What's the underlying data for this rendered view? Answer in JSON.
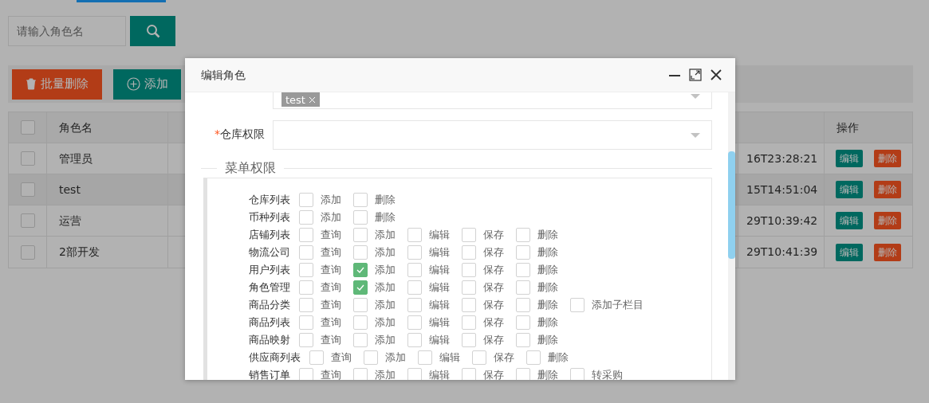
{
  "search": {
    "placeholder": "请输入角色名"
  },
  "toolbar": [
    {
      "label": "批量删除",
      "kind": "delete"
    },
    {
      "label": "添加",
      "kind": "add"
    }
  ],
  "table": {
    "all_checked": false,
    "name_header": "角色名",
    "actions_header": "操作",
    "rows": [
      {
        "name": "管理员",
        "time": "16T23:28:21",
        "checked": false,
        "hovered": false,
        "actions": [
          "编辑",
          "删除"
        ]
      },
      {
        "name": "test",
        "time": "15T14:51:04",
        "checked": false,
        "hovered": true,
        "actions": [
          "编辑",
          "删除"
        ]
      },
      {
        "name": "运营",
        "time": "29T10:39:42",
        "checked": false,
        "hovered": false,
        "actions": [
          "编辑",
          "删除"
        ]
      },
      {
        "name": "2部开发",
        "time": "29T10:41:39",
        "checked": false,
        "hovered": false,
        "actions": [
          "编辑",
          "删除"
        ]
      }
    ]
  },
  "modal": {
    "title": "编辑角色",
    "shop_select": {
      "tags": [
        "test"
      ]
    },
    "warehouse_select": {
      "label": "仓库权限",
      "required_mark": "*"
    },
    "menu_legend": "菜单权限",
    "menus": [
      {
        "label": "仓库列表",
        "perms": [
          {
            "label": "添加",
            "checked": false
          },
          {
            "label": "删除",
            "checked": false
          }
        ]
      },
      {
        "label": "币种列表",
        "perms": [
          {
            "label": "添加",
            "checked": false
          },
          {
            "label": "删除",
            "checked": false
          }
        ]
      },
      {
        "label": "店铺列表",
        "perms": [
          {
            "label": "查询",
            "checked": false
          },
          {
            "label": "添加",
            "checked": false
          },
          {
            "label": "编辑",
            "checked": false
          },
          {
            "label": "保存",
            "checked": false
          },
          {
            "label": "删除",
            "checked": false
          }
        ]
      },
      {
        "label": "物流公司",
        "perms": [
          {
            "label": "查询",
            "checked": false
          },
          {
            "label": "添加",
            "checked": false
          },
          {
            "label": "编辑",
            "checked": false
          },
          {
            "label": "保存",
            "checked": false
          },
          {
            "label": "删除",
            "checked": false
          }
        ]
      },
      {
        "label": "用户列表",
        "perms": [
          {
            "label": "查询",
            "checked": false
          },
          {
            "label": "添加",
            "checked": true
          },
          {
            "label": "编辑",
            "checked": false
          },
          {
            "label": "保存",
            "checked": false
          },
          {
            "label": "删除",
            "checked": false
          }
        ]
      },
      {
        "label": "角色管理",
        "perms": [
          {
            "label": "查询",
            "checked": false
          },
          {
            "label": "添加",
            "checked": true
          },
          {
            "label": "编辑",
            "checked": false
          },
          {
            "label": "保存",
            "checked": false
          },
          {
            "label": "删除",
            "checked": false
          }
        ]
      },
      {
        "label": "商品分类",
        "perms": [
          {
            "label": "查询",
            "checked": false
          },
          {
            "label": "添加",
            "checked": false
          },
          {
            "label": "编辑",
            "checked": false
          },
          {
            "label": "保存",
            "checked": false
          },
          {
            "label": "删除",
            "checked": false
          },
          {
            "label": "添加子栏目",
            "checked": false
          }
        ]
      },
      {
        "label": "商品列表",
        "perms": [
          {
            "label": "查询",
            "checked": false
          },
          {
            "label": "添加",
            "checked": false
          },
          {
            "label": "编辑",
            "checked": false
          },
          {
            "label": "保存",
            "checked": false
          },
          {
            "label": "删除",
            "checked": false
          }
        ]
      },
      {
        "label": "商品映射",
        "perms": [
          {
            "label": "查询",
            "checked": false
          },
          {
            "label": "添加",
            "checked": false
          },
          {
            "label": "编辑",
            "checked": false
          },
          {
            "label": "保存",
            "checked": false
          },
          {
            "label": "删除",
            "checked": false
          }
        ]
      },
      {
        "label": "供应商列表",
        "perms": [
          {
            "label": "查询",
            "checked": false
          },
          {
            "label": "添加",
            "checked": false
          },
          {
            "label": "编辑",
            "checked": false
          },
          {
            "label": "保存",
            "checked": false
          },
          {
            "label": "删除",
            "checked": false
          }
        ]
      },
      {
        "label": "销售订单",
        "perms": [
          {
            "label": "查询",
            "checked": false
          },
          {
            "label": "添加",
            "checked": false
          },
          {
            "label": "编辑",
            "checked": false
          },
          {
            "label": "保存",
            "checked": false
          },
          {
            "label": "删除",
            "checked": false
          },
          {
            "label": "转采购",
            "checked": false
          }
        ]
      }
    ]
  }
}
